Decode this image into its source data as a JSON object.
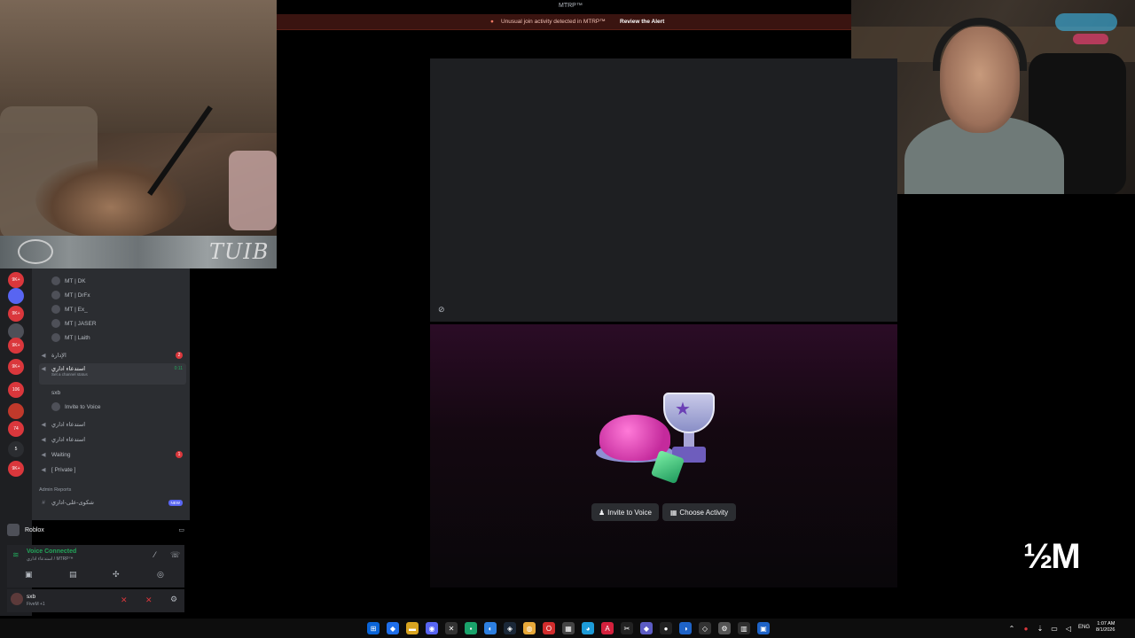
{
  "window": {
    "title": "MTRP™"
  },
  "alert": {
    "icon": "warning-icon",
    "message": "Unusual join activity detected in MTRP™",
    "link": "Review the Alert"
  },
  "stage": {
    "icon": "activity-icon",
    "invite_button": "Invite to Voice",
    "activity_button": "Choose Activity"
  },
  "overlay": {
    "cam_left_text": "TUIB",
    "watermark": "½M"
  },
  "server_rail": {
    "items": [
      {
        "label": "9K+",
        "color": "#da373c"
      },
      {
        "label": "",
        "color": "#5865f2"
      },
      {
        "label": "9K+",
        "color": "#da373c"
      },
      {
        "label": "",
        "color": "#4e5058"
      },
      {
        "label": "9K+",
        "color": "#da373c"
      },
      {
        "label": "9K+",
        "color": "#da373c"
      },
      {
        "label": "106",
        "color": "#da373c"
      },
      {
        "label": "",
        "color": "#c0392b"
      },
      {
        "label": "74",
        "color": "#da373c"
      },
      {
        "label": "5",
        "color": "#2b2d31"
      },
      {
        "label": "9K+",
        "color": "#da373c"
      }
    ]
  },
  "channels": {
    "users": [
      "MT | DK",
      "MT | DrFx",
      "MT | Ex_",
      "MT | JASER",
      "MT | Laith"
    ],
    "admin_channel": "الإدارة",
    "admin_badge": "2",
    "active_channel": "استدعاء اداري",
    "active_status": "Set a channel status",
    "active_timer": "0:11",
    "active_member": "sxb",
    "invite_voice": "Invite to Voice",
    "channel_2": "استدعاء اداري",
    "channel_3": "استدعاء اداري",
    "waiting": "Waiting",
    "waiting_badge": "1",
    "private": "[ Private ]",
    "category": "Admin Reports",
    "text_channel_1": "شكوى-على-اداري",
    "new_badge": "NEW"
  },
  "activity": {
    "game": "Roblox"
  },
  "voice": {
    "title": "Voice Connected",
    "sub": "استدعاء اداري / MTRP™"
  },
  "user": {
    "name": "sxb",
    "status": "FiveM +1"
  },
  "taskbar": {
    "lang": "ENG",
    "time": "1:07 AM",
    "date": "8/1/2026"
  }
}
